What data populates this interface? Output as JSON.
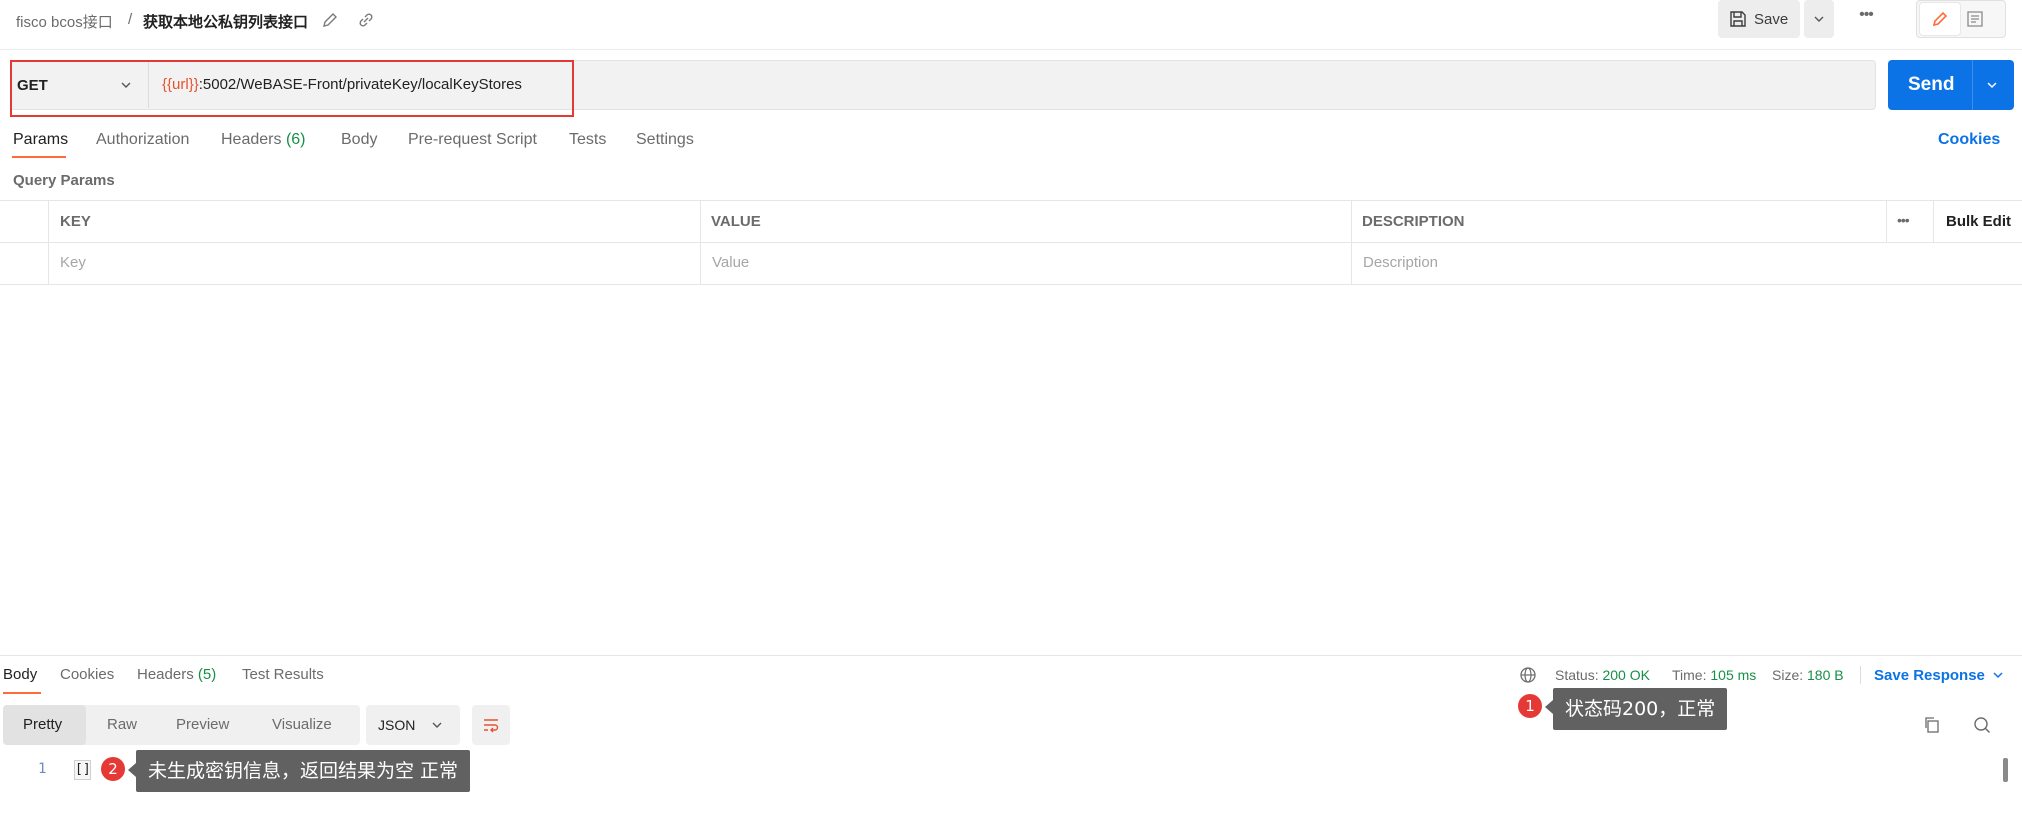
{
  "header": {
    "breadcrumb_parent": "fisco bcos接口",
    "breadcrumb_sep": "/",
    "breadcrumb_current": "获取本地公私钥列表接口",
    "save_label": "Save",
    "more_label": "•••"
  },
  "request": {
    "method": "GET",
    "url_variable": "{{url}}",
    "url_rest": ":5002/WeBASE-Front/privateKey/localKeyStores",
    "send_label": "Send",
    "tabs": [
      {
        "label": "Params"
      },
      {
        "label": "Authorization"
      },
      {
        "label": "Headers"
      },
      {
        "label": "Body"
      },
      {
        "label": "Pre-request Script"
      },
      {
        "label": "Tests"
      },
      {
        "label": "Settings"
      }
    ],
    "headers_count": "(6)",
    "cookies_label": "Cookies",
    "query_params_title": "Query Params",
    "table": {
      "columns": [
        "KEY",
        "VALUE",
        "DESCRIPTION"
      ],
      "bulk_edit": "Bulk Edit",
      "more": "•••",
      "placeholders": {
        "key": "Key",
        "value": "Value",
        "description": "Description"
      }
    }
  },
  "response": {
    "tabs": [
      {
        "label": "Body"
      },
      {
        "label": "Cookies"
      },
      {
        "label": "Headers"
      },
      {
        "label": "Test Results"
      }
    ],
    "headers_count": "(5)",
    "status_label": "Status:",
    "status_value": "200 OK",
    "time_label": "Time:",
    "time_value": "105 ms",
    "size_label": "Size:",
    "size_value": "180 B",
    "save_response": "Save Response",
    "formats": [
      "Pretty",
      "Raw",
      "Preview",
      "Visualize"
    ],
    "language": "JSON",
    "line_number": "1",
    "body": "[]"
  },
  "annotations": [
    {
      "number": "1",
      "text": "状态码200，正常"
    },
    {
      "number": "2",
      "text": "未生成密钥信息，返回结果为空 正常"
    }
  ],
  "colors": {
    "accent": "#ff6c37",
    "primary": "#0c73e6",
    "success": "#168f48",
    "highlight": "#e53935"
  }
}
